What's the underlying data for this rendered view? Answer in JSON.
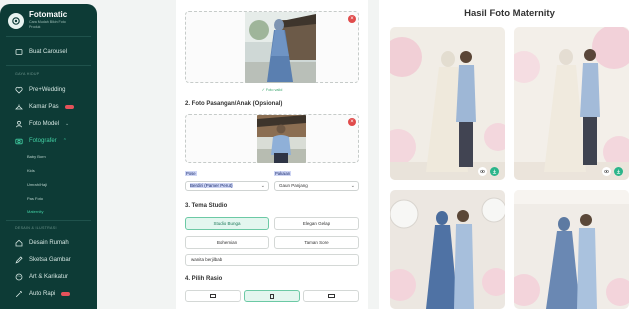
{
  "brand": {
    "title": "Fotomatic",
    "subtitle": "Cara Mudah Bikin Foto Produk"
  },
  "sidebar": {
    "top_items": [
      {
        "label": "Buat Carousel",
        "icon": "carousel-icon"
      }
    ],
    "section_gaya_hidup": "GAYA HIDUP",
    "lifestyle_items": [
      {
        "label": "Pre+Wedding",
        "icon": "heart-icon"
      },
      {
        "label": "Kamar Pas",
        "icon": "hanger-icon"
      },
      {
        "label": "Foto Model",
        "icon": "user-icon"
      },
      {
        "label": "Fotografer",
        "icon": "camera-icon"
      }
    ],
    "fotografer_subitems": [
      "Baby Born",
      "Kids",
      "Umrah/Haji",
      "Pas Foto",
      "Maternity"
    ],
    "section_desain": "DESAIN & ILUSTRASI",
    "design_items": [
      {
        "label": "Desain Rumah",
        "icon": "home-icon"
      },
      {
        "label": "Sketsa Gambar",
        "icon": "sketch-icon"
      },
      {
        "label": "Art & Karikatur",
        "icon": "palette-icon"
      },
      {
        "label": "Auto Rapi",
        "icon": "magic-icon"
      }
    ]
  },
  "form": {
    "upload1_ok": "✓ Foto valid",
    "section2_title": "2. Foto Pasangan/Anak (Opsional)",
    "pose_label": "Pose",
    "pose_value": "Berdiri (Pamer Perut)",
    "pakaian_label": "Pakaian",
    "pakaian_value": "Gaun Panjang",
    "section3_title": "3. Tema Studio",
    "themes": [
      "Studio Bunga",
      "Elegan Gelap",
      "Bohemian",
      "Taman Sore"
    ],
    "theme_selected": "Studio Bunga",
    "custom_prompt": "wanita berjilbab",
    "section4_title": "4. Pilih Rasio"
  },
  "results": {
    "title": "Hasil Foto Maternity"
  },
  "colors": {
    "sidebar_bg": "#0d3b36",
    "accent": "#2bb58a",
    "danger": "#e04b4b"
  }
}
